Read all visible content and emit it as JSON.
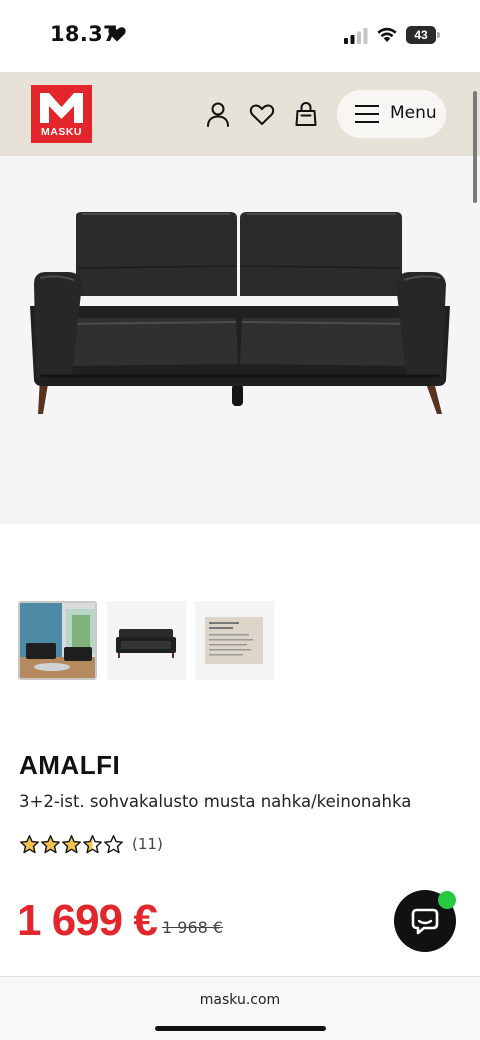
{
  "status_bar": {
    "time": "18.37",
    "battery": "43",
    "icons": [
      "heart-icon",
      "signal-icon",
      "wifi-icon",
      "battery-icon"
    ]
  },
  "header": {
    "logo_text": "MASKU",
    "brand_color": "#e3262b",
    "header_bg": "#e6e2d8",
    "icons": [
      "user-icon",
      "favorites-heart-icon",
      "shopping-bag-icon"
    ],
    "menu_label": "Menu"
  },
  "product": {
    "name": "AMALFI",
    "subtitle": "3+2-ist. sohvakalusto musta nahka/keinonahka",
    "rating": {
      "value": 3.5,
      "max": 5,
      "count": "(11)"
    },
    "price": "1 699 €",
    "old_price": "1 968 €",
    "price_color": "#e3262b",
    "thumbnail_count": 3
  },
  "chat": {
    "icon": "chat-bubble-icon",
    "status_color": "#27c93f"
  },
  "browser": {
    "url": "masku.com"
  }
}
